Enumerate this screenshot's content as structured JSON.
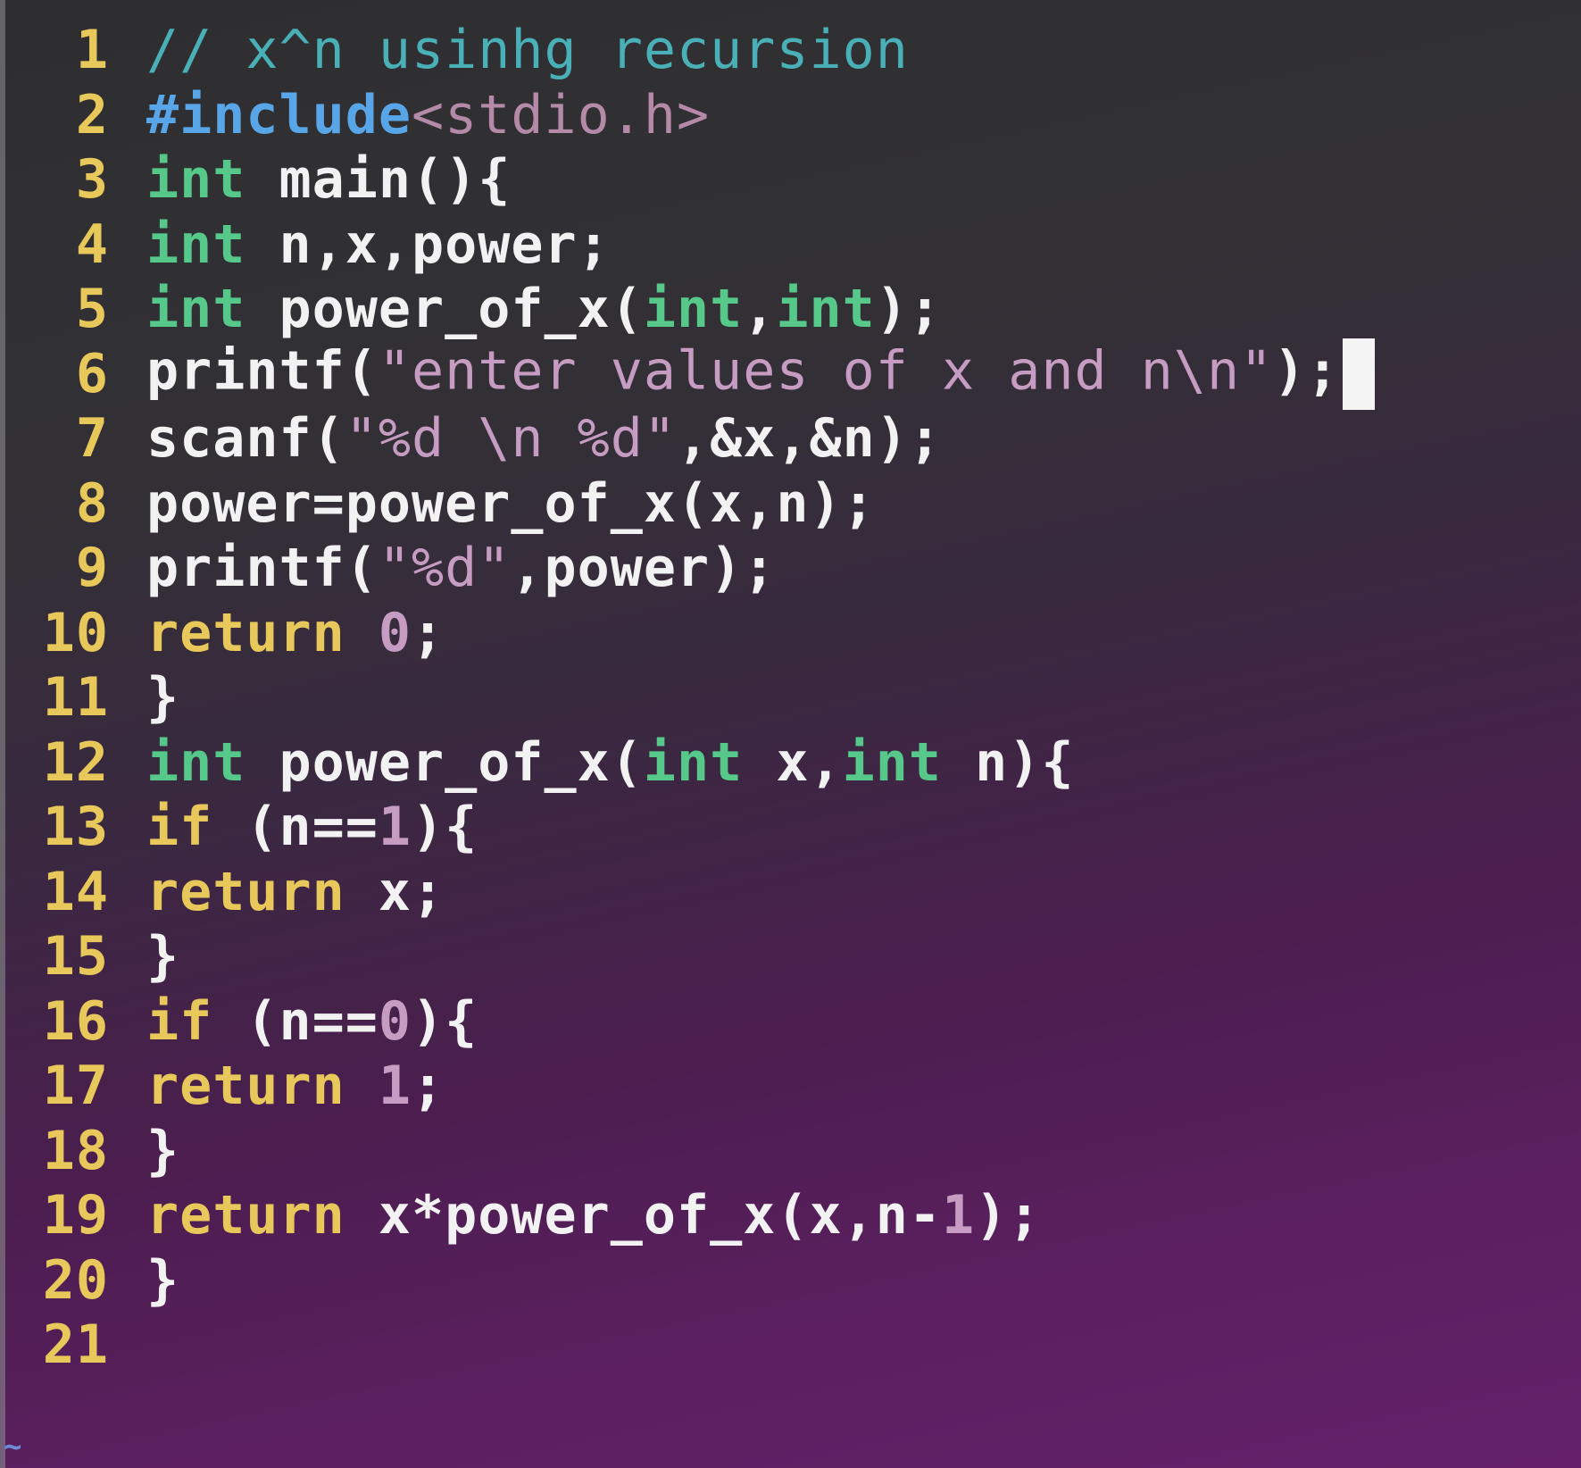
{
  "editor": {
    "lines": [
      {
        "num": "1",
        "segments": [
          {
            "text": "// x^n usinhg recursion",
            "kind": "comment"
          }
        ]
      },
      {
        "num": "2",
        "segments": [
          {
            "text": "#include",
            "kind": "pre"
          },
          {
            "text": "<stdio.h>",
            "kind": "hdr"
          }
        ]
      },
      {
        "num": "3",
        "segments": [
          {
            "text": "int",
            "kind": "type"
          },
          {
            "text": " main(){",
            "kind": "plain"
          }
        ]
      },
      {
        "num": "4",
        "segments": [
          {
            "text": "int",
            "kind": "type"
          },
          {
            "text": " n,x,power;",
            "kind": "plain"
          }
        ]
      },
      {
        "num": "5",
        "segments": [
          {
            "text": "int",
            "kind": "type"
          },
          {
            "text": " power_of_x(",
            "kind": "plain"
          },
          {
            "text": "int",
            "kind": "type"
          },
          {
            "text": ",",
            "kind": "plain"
          },
          {
            "text": "int",
            "kind": "type"
          },
          {
            "text": ");",
            "kind": "plain"
          }
        ]
      },
      {
        "num": "6",
        "segments": [
          {
            "text": "printf(",
            "kind": "plain"
          },
          {
            "text": "\"enter values of x and n\\n\"",
            "kind": "str"
          },
          {
            "text": ");",
            "kind": "plain"
          }
        ],
        "cursor": true
      },
      {
        "num": "7",
        "segments": [
          {
            "text": "scanf(",
            "kind": "plain"
          },
          {
            "text": "\"%d \\n %d\"",
            "kind": "str"
          },
          {
            "text": ",&x,&n);",
            "kind": "plain"
          }
        ]
      },
      {
        "num": "8",
        "segments": [
          {
            "text": "power=power_of_x(x,n);",
            "kind": "plain"
          }
        ]
      },
      {
        "num": "9",
        "segments": [
          {
            "text": "printf(",
            "kind": "plain"
          },
          {
            "text": "\"%d\"",
            "kind": "str"
          },
          {
            "text": ",power);",
            "kind": "plain"
          }
        ]
      },
      {
        "num": "10",
        "segments": [
          {
            "text": "return",
            "kind": "ctl"
          },
          {
            "text": " ",
            "kind": "plain"
          },
          {
            "text": "0",
            "kind": "num"
          },
          {
            "text": ";",
            "kind": "plain"
          }
        ]
      },
      {
        "num": "11",
        "segments": [
          {
            "text": "}",
            "kind": "plain"
          }
        ]
      },
      {
        "num": "12",
        "segments": [
          {
            "text": "int",
            "kind": "type"
          },
          {
            "text": " power_of_x(",
            "kind": "plain"
          },
          {
            "text": "int",
            "kind": "type"
          },
          {
            "text": " x,",
            "kind": "plain"
          },
          {
            "text": "int",
            "kind": "type"
          },
          {
            "text": " n){",
            "kind": "plain"
          }
        ]
      },
      {
        "num": "13",
        "segments": [
          {
            "text": "if",
            "kind": "ctl"
          },
          {
            "text": " (n==",
            "kind": "plain"
          },
          {
            "text": "1",
            "kind": "num"
          },
          {
            "text": "){",
            "kind": "plain"
          }
        ]
      },
      {
        "num": "14",
        "segments": [
          {
            "text": "return",
            "kind": "ctl"
          },
          {
            "text": " x;",
            "kind": "plain"
          }
        ]
      },
      {
        "num": "15",
        "segments": [
          {
            "text": "}",
            "kind": "plain"
          }
        ]
      },
      {
        "num": "16",
        "segments": [
          {
            "text": "if",
            "kind": "ctl"
          },
          {
            "text": " (n==",
            "kind": "plain"
          },
          {
            "text": "0",
            "kind": "num"
          },
          {
            "text": "){",
            "kind": "plain"
          }
        ]
      },
      {
        "num": "17",
        "segments": [
          {
            "text": "return",
            "kind": "ctl"
          },
          {
            "text": " ",
            "kind": "plain"
          },
          {
            "text": "1",
            "kind": "num"
          },
          {
            "text": ";",
            "kind": "plain"
          }
        ]
      },
      {
        "num": "18",
        "segments": [
          {
            "text": "}",
            "kind": "plain"
          }
        ]
      },
      {
        "num": "19",
        "segments": [
          {
            "text": "return",
            "kind": "ctl"
          },
          {
            "text": " x*power_of_x(x,n-",
            "kind": "plain"
          },
          {
            "text": "1",
            "kind": "num"
          },
          {
            "text": ");",
            "kind": "plain"
          }
        ]
      },
      {
        "num": "20",
        "segments": [
          {
            "text": "}",
            "kind": "plain"
          }
        ]
      },
      {
        "num": "21",
        "segments": []
      }
    ],
    "empty_line_marker": "~"
  },
  "colors": {
    "line_number": "#e8c85a",
    "comment": "#4ab0b8",
    "preprocessor": "#58a6e8",
    "header": "#b58aa8",
    "type": "#56c98a",
    "plain": "#f2f2f2",
    "string": "#c79cc2",
    "control": "#e8c85a",
    "number": "#c79cc2",
    "cursor": "#f4f4f4"
  }
}
